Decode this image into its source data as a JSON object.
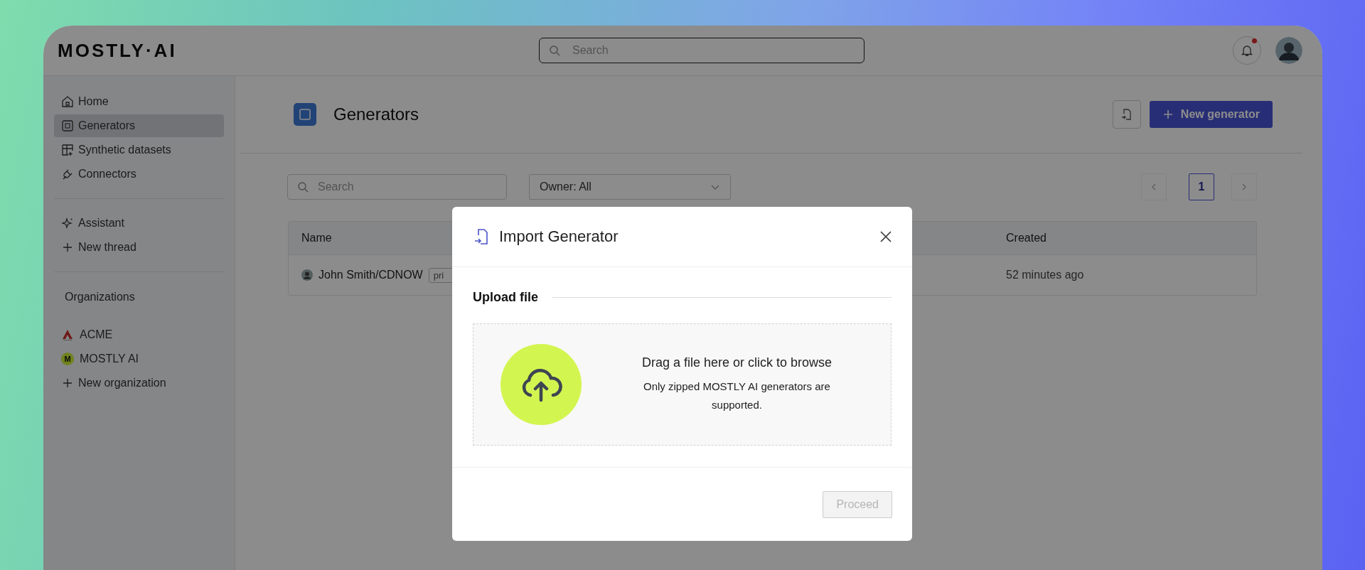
{
  "header": {
    "logo": "MOSTLY·AI",
    "search": {
      "placeholder": "Search"
    },
    "notifications": {
      "unread": true
    }
  },
  "sidebar": {
    "nav": [
      {
        "label": "Home",
        "selected": false
      },
      {
        "label": "Generators",
        "selected": true
      },
      {
        "label": "Synthetic datasets",
        "selected": false
      },
      {
        "label": "Connectors",
        "selected": false
      }
    ],
    "assistant": [
      {
        "label": "Assistant",
        "selected": false
      },
      {
        "label": "New thread",
        "selected": false
      }
    ],
    "organizations": {
      "heading": "Organizations",
      "items": [
        {
          "kind": "logo",
          "label": "ACME",
          "selected": false
        },
        {
          "kind": "badge",
          "badge": "M",
          "label": "MOSTLY AI",
          "selected": false
        },
        {
          "kind": "add",
          "label": "New organization",
          "selected": false
        }
      ]
    }
  },
  "main": {
    "title": "Generators",
    "new_button": "New generator",
    "search": {
      "placeholder": "Search"
    },
    "owner_filter": "Owner: All",
    "pages": [
      {
        "label": "1",
        "selected": true
      }
    ],
    "table": {
      "columns": [
        "Name",
        "Created"
      ],
      "rows": [
        {
          "name": "John Smith/CDNOW",
          "tag": "pri",
          "created": "52 minutes ago"
        }
      ]
    }
  },
  "modal": {
    "title": "Import Generator",
    "section": "Upload file",
    "drop_title": "Drag a file here or click to browse",
    "drop_hint": "Only zipped MOSTLY AI generators are supported.",
    "button": {
      "label": "Proceed",
      "disabled": true
    }
  }
}
